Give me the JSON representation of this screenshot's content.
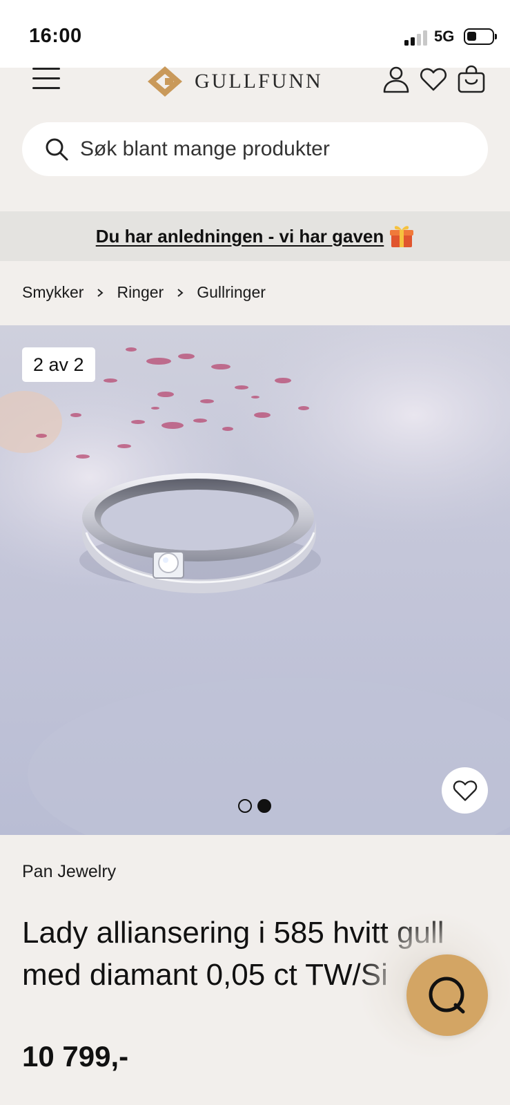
{
  "status_bar": {
    "time": "16:00",
    "network": "5G"
  },
  "header": {
    "logo_text": "GULLFUNN",
    "brand_color": "#c9995a",
    "icons": [
      "menu-icon",
      "user-icon",
      "heart-icon",
      "bag-icon"
    ]
  },
  "search": {
    "placeholder": "Søk blant mange produkter",
    "value": ""
  },
  "promo": {
    "text": "Du har anledningen - vi har gaven",
    "icon": "gift-icon"
  },
  "breadcrumb": {
    "items": [
      "Smykker",
      "Ringer",
      "Gullringer"
    ]
  },
  "gallery": {
    "counter": "2 av 2",
    "current_index": 2,
    "total": 2
  },
  "product": {
    "brand": "Pan Jewelry",
    "title": "Lady alliansering i 585 hvitt gull med diamant 0,05 ct TW/Si",
    "price": "10 799,-"
  },
  "chat": {
    "icon": "chat-icon",
    "color": "#d3a564"
  }
}
